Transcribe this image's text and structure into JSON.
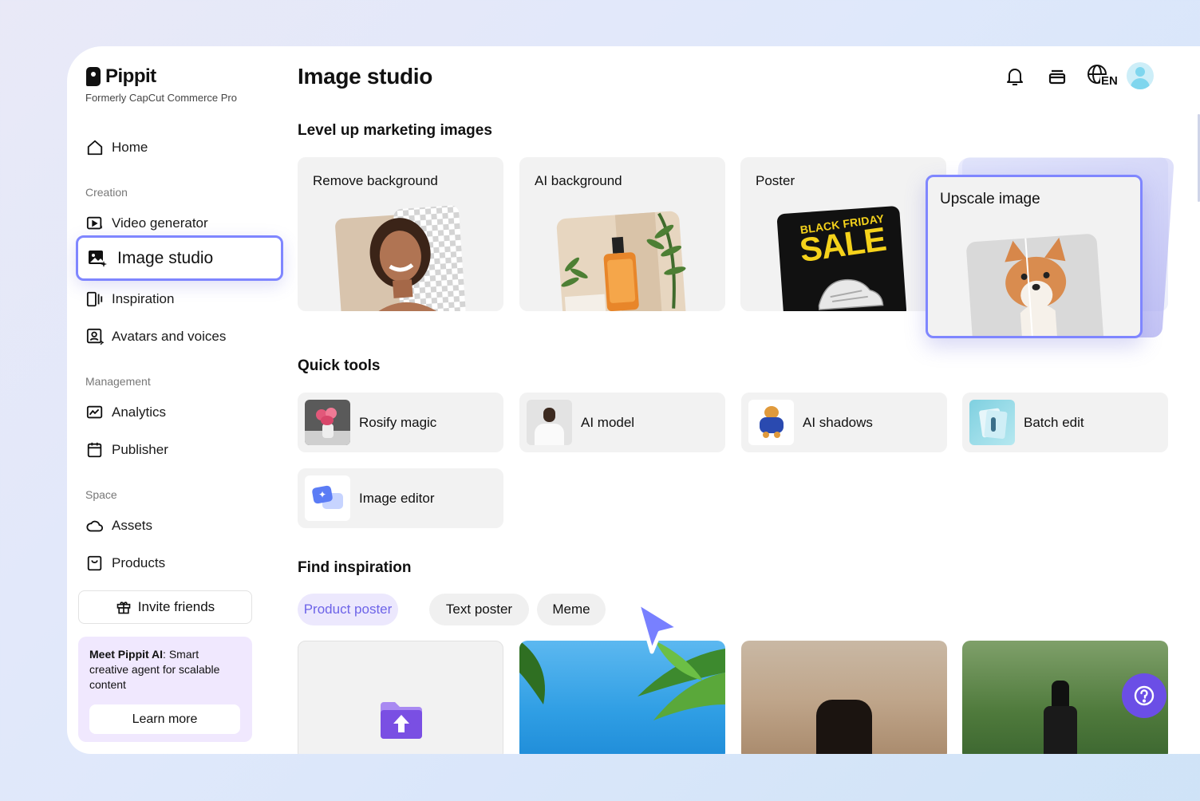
{
  "brand": {
    "name": "Pippit",
    "subtitle": "Formerly CapCut Commerce Pro"
  },
  "sidebar": {
    "home": "Home",
    "sections": {
      "creation": "Creation",
      "management": "Management",
      "space": "Space"
    },
    "items": {
      "video_generator": "Video generator",
      "image_studio": "Image studio",
      "inspiration": "Inspiration",
      "avatars": "Avatars and voices",
      "analytics": "Analytics",
      "publisher": "Publisher",
      "assets": "Assets",
      "products": "Products"
    },
    "invite": "Invite friends",
    "promo": {
      "bold": "Meet Pippit AI",
      "text": ": Smart creative agent for scalable content",
      "button": "Learn more"
    }
  },
  "header": {
    "title": "Image studio",
    "language": "EN"
  },
  "marketing": {
    "title": "Level up marketing images",
    "cards": {
      "remove_bg": "Remove background",
      "ai_bg": "AI background",
      "poster": "Poster",
      "upscale": "Upscale image"
    },
    "poster_text": {
      "line1": "BLACK FRIDAY",
      "line2": "SALE"
    }
  },
  "quick_tools": {
    "title": "Quick tools",
    "items": {
      "rosify": "Rosify magic",
      "ai_model": "AI model",
      "ai_shadows": "AI shadows",
      "batch_edit": "Batch edit",
      "image_editor": "Image editor"
    }
  },
  "inspiration": {
    "title": "Find inspiration",
    "chips": {
      "product_poster": "Product poster",
      "text_poster": "Text poster",
      "meme": "Meme"
    }
  },
  "colors": {
    "accent": "#7f86ff",
    "help": "#6b4ee6",
    "chip_active_text": "#6d63e8"
  }
}
